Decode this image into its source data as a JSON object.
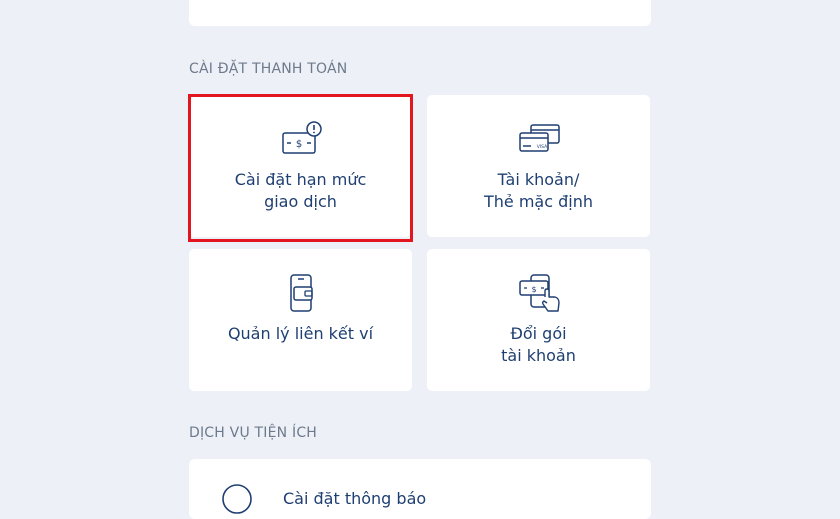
{
  "section_payment": {
    "title": "CÀI ĐẶT THANH TOÁN",
    "tiles": [
      {
        "line1": "Cài đặt hạn mức",
        "line2": "giao dịch",
        "icon": "card-limit-icon"
      },
      {
        "line1": "Tài khoản/",
        "line2": "Thẻ mặc định",
        "icon": "cards-icon"
      },
      {
        "line1": "Quản lý liên kết ví",
        "line2": "",
        "icon": "phone-wallet-icon"
      },
      {
        "line1": "Đổi gói",
        "line2": "tài khoản",
        "icon": "money-swap-icon"
      }
    ]
  },
  "section_services": {
    "title": "DỊCH VỤ TIỆN ÍCH",
    "partial_item_label": "Cài đặt thông báo"
  },
  "colors": {
    "background": "#edf1f7",
    "card": "#ffffff",
    "text_primary": "#1f3f72",
    "section_text": "#6e7a8c",
    "highlight": "#e3161f"
  }
}
